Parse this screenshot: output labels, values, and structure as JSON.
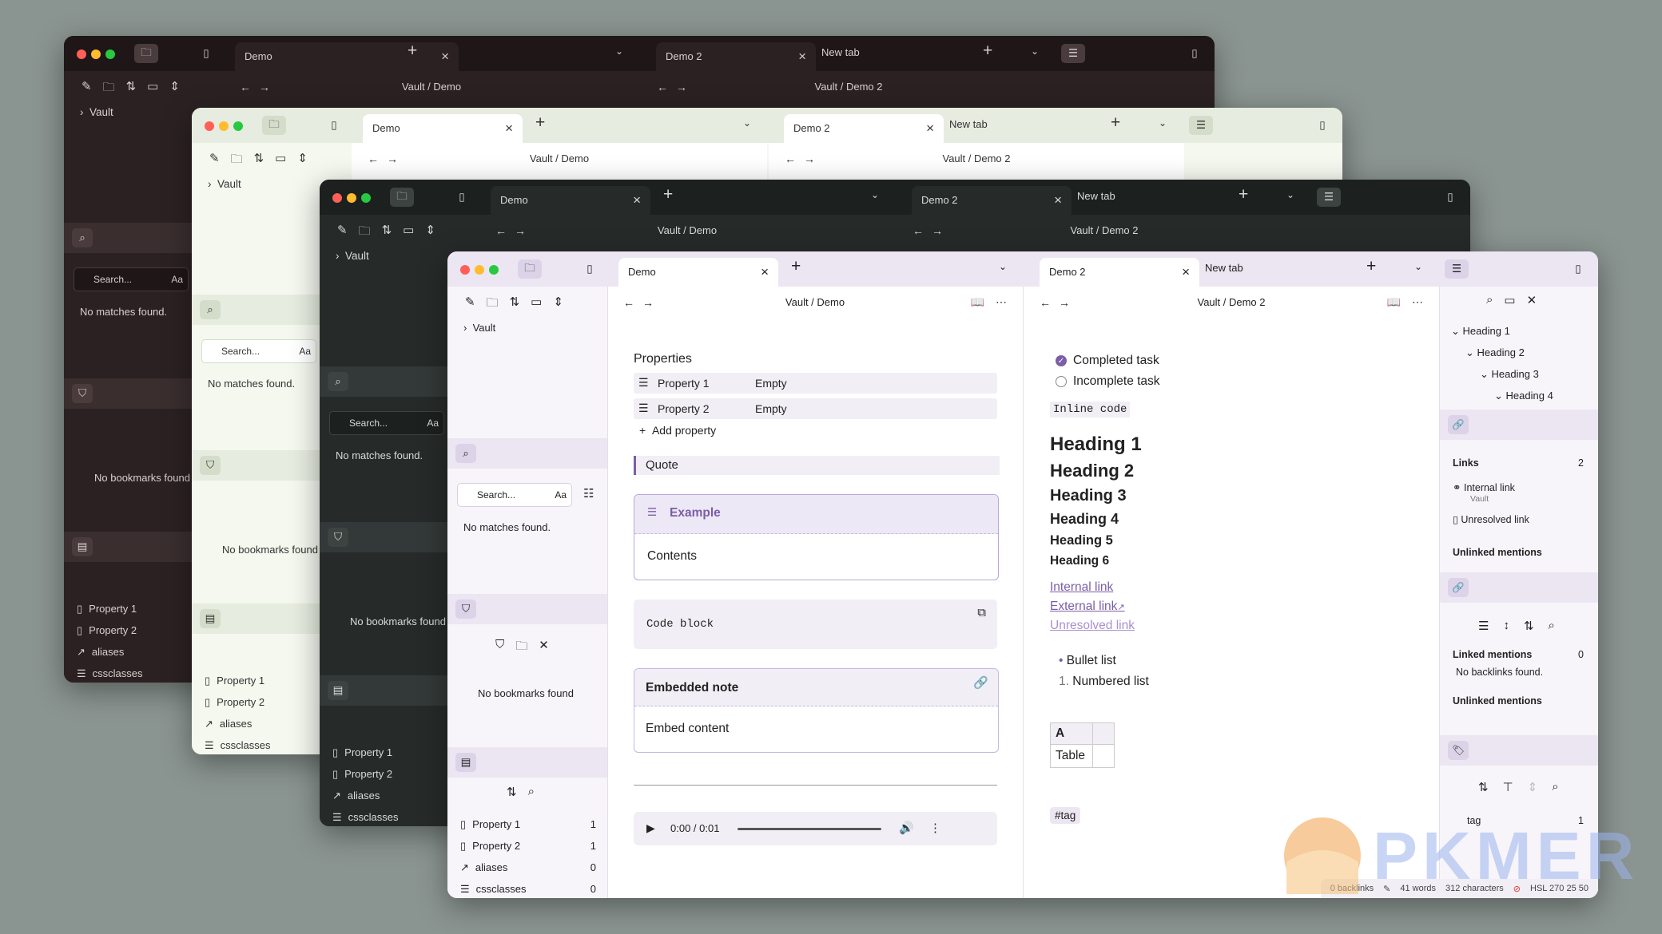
{
  "common": {
    "vault": "Vault",
    "search_placeholder": "Search...",
    "match_case": "Aa",
    "no_matches": "No matches found.",
    "no_bookmarks": "No bookmarks found",
    "add_property": "Add property"
  },
  "tabs": {
    "demo": "Demo",
    "demo2": "Demo 2",
    "new_tab": "New tab"
  },
  "breadcrumbs": {
    "demo": "Vault / Demo",
    "demo2": "Vault / Demo 2"
  },
  "properties_panel": [
    {
      "name": "Property 1",
      "count": "1"
    },
    {
      "name": "Property 2",
      "count": "1"
    },
    {
      "name": "aliases",
      "count": "0"
    },
    {
      "name": "cssclasses",
      "count": "0"
    }
  ],
  "editor1": {
    "heading": "Properties",
    "props": [
      {
        "key": "Property 1",
        "value": "Empty"
      },
      {
        "key": "Property 2",
        "value": "Empty"
      }
    ],
    "quote": "Quote",
    "callout": {
      "title": "Example",
      "content": "Contents"
    },
    "code": "Code block",
    "embed": {
      "title": "Embedded note",
      "content": "Embed content"
    },
    "audio": {
      "time": "0:00 / 0:01"
    }
  },
  "editor2": {
    "tasks": [
      {
        "label": "Completed task",
        "done": true
      },
      {
        "label": "Incomplete task",
        "done": false
      }
    ],
    "inline_code": "Inline code",
    "headings": [
      "Heading 1",
      "Heading 2",
      "Heading 3",
      "Heading 4",
      "Heading 5",
      "Heading 6"
    ],
    "links": {
      "internal": "Internal link",
      "external": "External link",
      "unresolved": "Unresolved link"
    },
    "bullet": "Bullet list",
    "numbered_marker": "1.",
    "numbered": "Numbered list",
    "table": {
      "header": "A",
      "cell": "Table"
    },
    "tag": "#tag"
  },
  "right": {
    "outline": [
      "Heading 1",
      "Heading 2",
      "Heading 3",
      "Heading 4"
    ],
    "links_title": "Links",
    "links_count": "2",
    "internal_link": "Internal link",
    "internal_sub": "Vault",
    "unresolved_link": "Unresolved link",
    "unlinked": "Unlinked mentions",
    "linked_title": "Linked mentions",
    "linked_count": "0",
    "no_backlinks": "No backlinks found.",
    "tag_name": "tag",
    "tag_count": "1"
  },
  "status": {
    "backlinks": "0 backlinks",
    "words": "41 words",
    "chars": "312 characters",
    "color": "HSL 270 25 50"
  },
  "watermark": "PKMER",
  "colors": {
    "accent": "#7b5ea7",
    "win1": "#2b2122",
    "win2": "#f4f8ef",
    "win3": "#262b2a",
    "win4": "#ffffff"
  }
}
